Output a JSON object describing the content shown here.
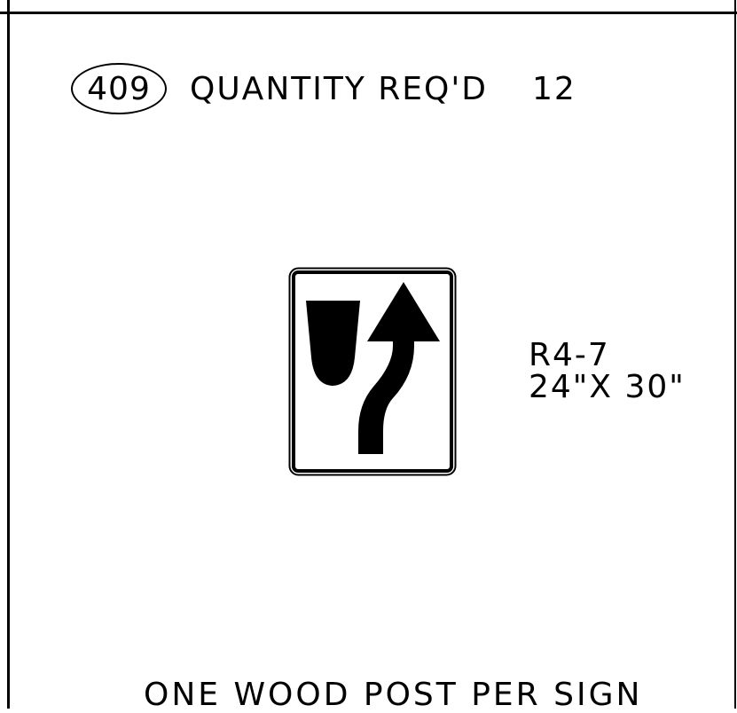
{
  "item_number": "409",
  "quantity": {
    "label": "QUANTITY REQ'D",
    "value": "12"
  },
  "sign": {
    "code": "R4-7",
    "size": "24\"X 30\"",
    "icon": "keep-right-sign-icon",
    "colors": {
      "background": "#ffffff",
      "legend": "#000000",
      "border": "#000000"
    }
  },
  "note": "ONE WOOD POST PER SIGN"
}
